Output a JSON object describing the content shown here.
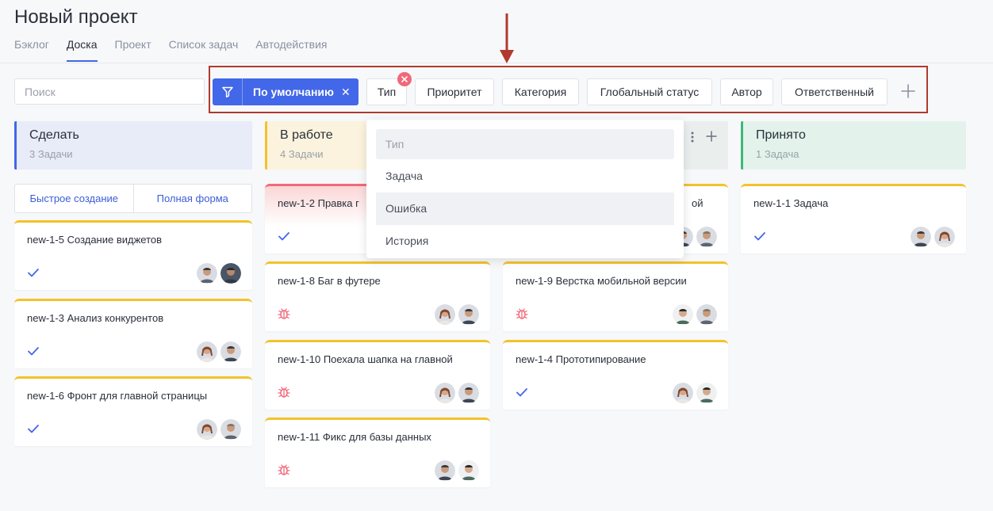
{
  "project": {
    "title": "Новый проект"
  },
  "tabs": [
    {
      "label": "Бэклог"
    },
    {
      "label": "Доска"
    },
    {
      "label": "Проект"
    },
    {
      "label": "Список задач"
    },
    {
      "label": "Автодействия"
    }
  ],
  "search": {
    "placeholder": "Поиск"
  },
  "filters": {
    "default_label": "По умолчанию",
    "chips": [
      "Тип",
      "Приоритет",
      "Категория",
      "Глобальный статус",
      "Автор",
      "Ответственный"
    ]
  },
  "columns": [
    {
      "title": "Сделать",
      "count": "3 Задачи",
      "accent": "#4267e8",
      "bg": "#e8ebf8"
    },
    {
      "title": "В работе",
      "count": "4 Задачи",
      "accent": "#f2c32a",
      "bg": "#fbf3dd"
    },
    {
      "title": "",
      "count": "",
      "accent": "",
      "bg": "#eaefee"
    },
    {
      "title": "Принято",
      "count": "1 Задача",
      "accent": "#3cb878",
      "bg": "#e3f3ec"
    }
  ],
  "quick_create": {
    "quick_label": "Быстрое создание",
    "full_label": "Полная форма"
  },
  "cards": {
    "c1": {
      "id": "new-1-5",
      "title": "Создание виджетов",
      "type": "check-icon"
    },
    "c2": {
      "id": "new-1-3",
      "title": "Анализ конкурентов",
      "type": "check-icon"
    },
    "c3": {
      "id": "new-1-6",
      "title": "Фронт для главной страницы",
      "type": "check-icon"
    },
    "c4": {
      "id": "new-1-2",
      "title": "Правка г",
      "type": "check-icon"
    },
    "c5": {
      "id": "new-1-8",
      "title": "Баг в футере",
      "type": "bug-icon"
    },
    "c6": {
      "id": "new-1-10",
      "title": "Поехала шапка на главной",
      "type": "bug-icon"
    },
    "c7": {
      "id": "new-1-11",
      "title": "Фикс для базы данных",
      "type": "bug-icon"
    },
    "c8": {
      "id": "",
      "title": "ой",
      "type": ""
    },
    "c9": {
      "id": "new-1-9",
      "title": "Верстка мобильной версии",
      "type": "bug-icon"
    },
    "c10": {
      "id": "new-1-4",
      "title": "Прототипирование",
      "type": "check-icon"
    },
    "c11": {
      "id": "new-1-1",
      "title": "Задача",
      "type": "check-icon"
    }
  },
  "type_dropdown": {
    "placeholder": "Тип",
    "options": [
      "Задача",
      "Ошибка",
      "История"
    ]
  },
  "colors": {
    "primary": "#4267e8",
    "annotation": "#b03a2e",
    "bug": "#f0697a"
  }
}
